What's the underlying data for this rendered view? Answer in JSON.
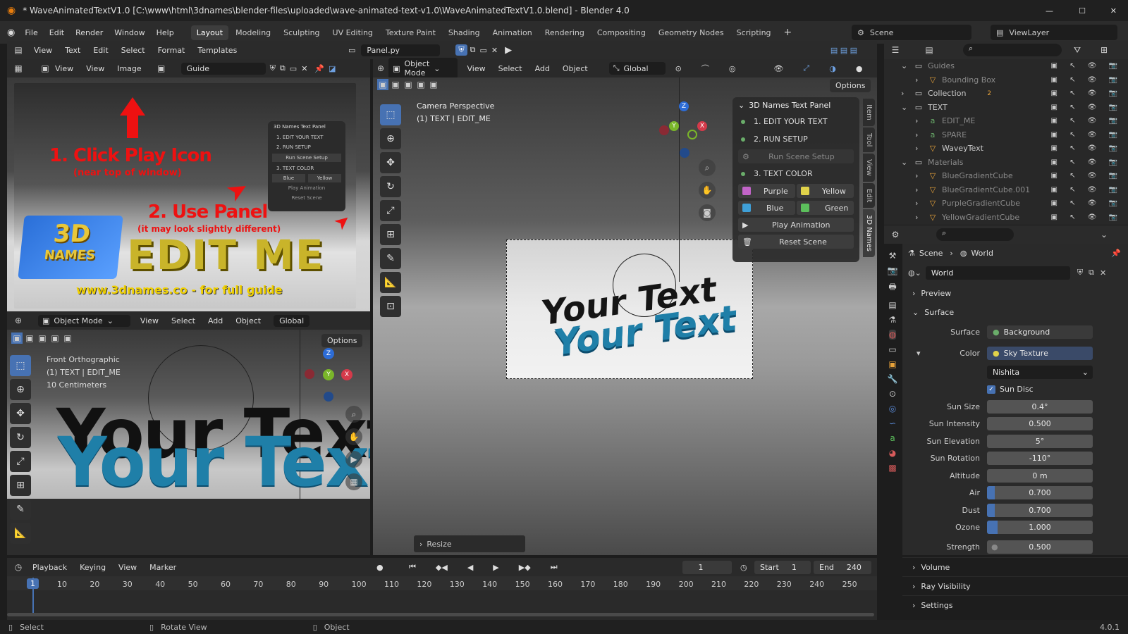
{
  "window": {
    "title": "* WaveAnimatedTextV1.0 [C:\\www\\html\\3dnames\\blender-files\\uploaded\\wave-animated-text-v1.0\\WaveAnimatedTextV1.0.blend] - Blender 4.0",
    "minimize": "—",
    "maximize": "☐",
    "close": "✕"
  },
  "menubar": {
    "items": [
      "File",
      "Edit",
      "Render",
      "Window",
      "Help"
    ],
    "workspaces": [
      "Layout",
      "Modeling",
      "Sculpting",
      "UV Editing",
      "Texture Paint",
      "Shading",
      "Animation",
      "Rendering",
      "Compositing",
      "Geometry Nodes",
      "Scripting"
    ],
    "active_workspace": "Layout",
    "add": "+",
    "scene": "Scene",
    "view_layer": "ViewLayer"
  },
  "text_editor": {
    "menus": [
      "View",
      "Text",
      "Edit",
      "Select",
      "Format",
      "Templates"
    ],
    "file": "Panel.py"
  },
  "image_editor": {
    "menus": [
      "View",
      "View",
      "Image"
    ],
    "image_name": "Guide",
    "annotation1": "1. Click Play Icon",
    "annotation1_sub": "(near top of window)",
    "annotation2": "2. Use Panel",
    "annotation2_sub": "(it may look slightly different)",
    "logo_top": "3D",
    "logo_bottom": "NAMES",
    "edit_me": "EDIT ME",
    "url": "www.3dnames.co - for full guide",
    "mini_panel": {
      "title": "3D Names Text Panel",
      "items": [
        "1. EDIT YOUR TEXT",
        "2. RUN SETUP",
        "Run Scene Setup",
        "3. TEXT COLOR",
        "Blue",
        "Yellow",
        "Play Animation",
        "Reset Scene"
      ]
    }
  },
  "front_view": {
    "mode": "Object Mode",
    "menus": [
      "View",
      "Select",
      "Add",
      "Object"
    ],
    "orientation": "Global",
    "options": "Options",
    "overlay_title": "Front Orthographic",
    "overlay_obj": "(1) TEXT | EDIT_ME",
    "overlay_scale": "10 Centimeters",
    "text": "Your Text"
  },
  "main_view": {
    "mode": "Object Mode",
    "menus": [
      "View",
      "Select",
      "Add",
      "Object"
    ],
    "orientation": "Global",
    "options": "Options",
    "overlay_title": "Camera Perspective",
    "overlay_obj": "(1) TEXT | EDIT_ME",
    "text": "Your Text",
    "resize": "Resize",
    "side_tabs": [
      "Item",
      "Tool",
      "View",
      "Edit",
      "3D Names"
    ],
    "gizmo": {
      "x": "X",
      "y": "Y",
      "z": "Z"
    }
  },
  "names_panel": {
    "title": "3D Names Text Panel",
    "step1": "1. EDIT YOUR TEXT",
    "step2": "2. RUN SETUP",
    "run_setup": "Run Scene Setup",
    "step3": "3. TEXT COLOR",
    "colors": [
      {
        "label": "Purple",
        "hex": "#c264c8"
      },
      {
        "label": "Yellow",
        "hex": "#e0d24a"
      },
      {
        "label": "Blue",
        "hex": "#3fa0d8"
      },
      {
        "label": "Green",
        "hex": "#5cbf5c"
      }
    ],
    "play": "Play Animation",
    "reset": "Reset Scene"
  },
  "outliner": {
    "rows": [
      {
        "label": "Guides",
        "icon": "collection-icon",
        "dim": true
      },
      {
        "label": "Bounding Box",
        "icon": "mesh-icon",
        "dim": true
      },
      {
        "label": "Collection",
        "icon": "collection-icon",
        "dim": false
      },
      {
        "label": "TEXT",
        "icon": "collection-icon",
        "dim": false
      },
      {
        "label": "EDIT_ME",
        "icon": "font-icon",
        "dim": true
      },
      {
        "label": "SPARE",
        "icon": "font-icon",
        "dim": true
      },
      {
        "label": "WaveyText",
        "icon": "mesh-icon",
        "dim": false
      },
      {
        "label": "Materials",
        "icon": "collection-icon",
        "dim": true
      },
      {
        "label": "BlueGradientCube",
        "icon": "mesh-icon",
        "dim": true
      },
      {
        "label": "BlueGradientCube.001",
        "icon": "mesh-icon",
        "dim": true
      },
      {
        "label": "PurpleGradientCube",
        "icon": "mesh-icon",
        "dim": true
      },
      {
        "label": "YellowGradientCube",
        "icon": "mesh-icon",
        "dim": true
      }
    ],
    "collection_badge": "2"
  },
  "properties": {
    "breadcrumb_scene": "Scene",
    "breadcrumb_world": "World",
    "world_name": "World",
    "sections": {
      "preview": "Preview",
      "surface": "Surface",
      "volume": "Volume",
      "ray": "Ray Visibility",
      "settings": "Settings"
    },
    "surface_label": "Surface",
    "surface_value": "Background",
    "color_label": "Color",
    "color_value": "Sky Texture",
    "sky_type": "Nishita",
    "sun_disc": "Sun Disc",
    "fields": [
      {
        "label": "Sun Size",
        "value": "0.4°",
        "fill": 0
      },
      {
        "label": "Sun Intensity",
        "value": "0.500",
        "fill": 0
      },
      {
        "label": "Sun Elevation",
        "value": "5°",
        "fill": 0
      },
      {
        "label": "Sun Rotation",
        "value": "-110°",
        "fill": 0
      },
      {
        "label": "Altitude",
        "value": "0 m",
        "fill": 0
      },
      {
        "label": "Air",
        "value": "0.700",
        "fill": 0.07
      },
      {
        "label": "Dust",
        "value": "0.700",
        "fill": 0.07
      },
      {
        "label": "Ozone",
        "value": "1.000",
        "fill": 0.1
      }
    ],
    "strength_label": "Strength",
    "strength_value": "0.500"
  },
  "timeline": {
    "menus": [
      "Playback",
      "Keying",
      "View",
      "Marker"
    ],
    "current": "1",
    "start_label": "Start",
    "start": "1",
    "end_label": "End",
    "end": "240",
    "ticks": [
      "10",
      "20",
      "30",
      "40",
      "50",
      "60",
      "70",
      "80",
      "90",
      "100",
      "110",
      "120",
      "130",
      "140",
      "150",
      "160",
      "170",
      "180",
      "190",
      "200",
      "210",
      "220",
      "230",
      "240",
      "250"
    ],
    "marker": "1"
  },
  "statusbar": {
    "select": "Select",
    "rotate": "Rotate View",
    "object": "Object",
    "version": "4.0.1"
  }
}
